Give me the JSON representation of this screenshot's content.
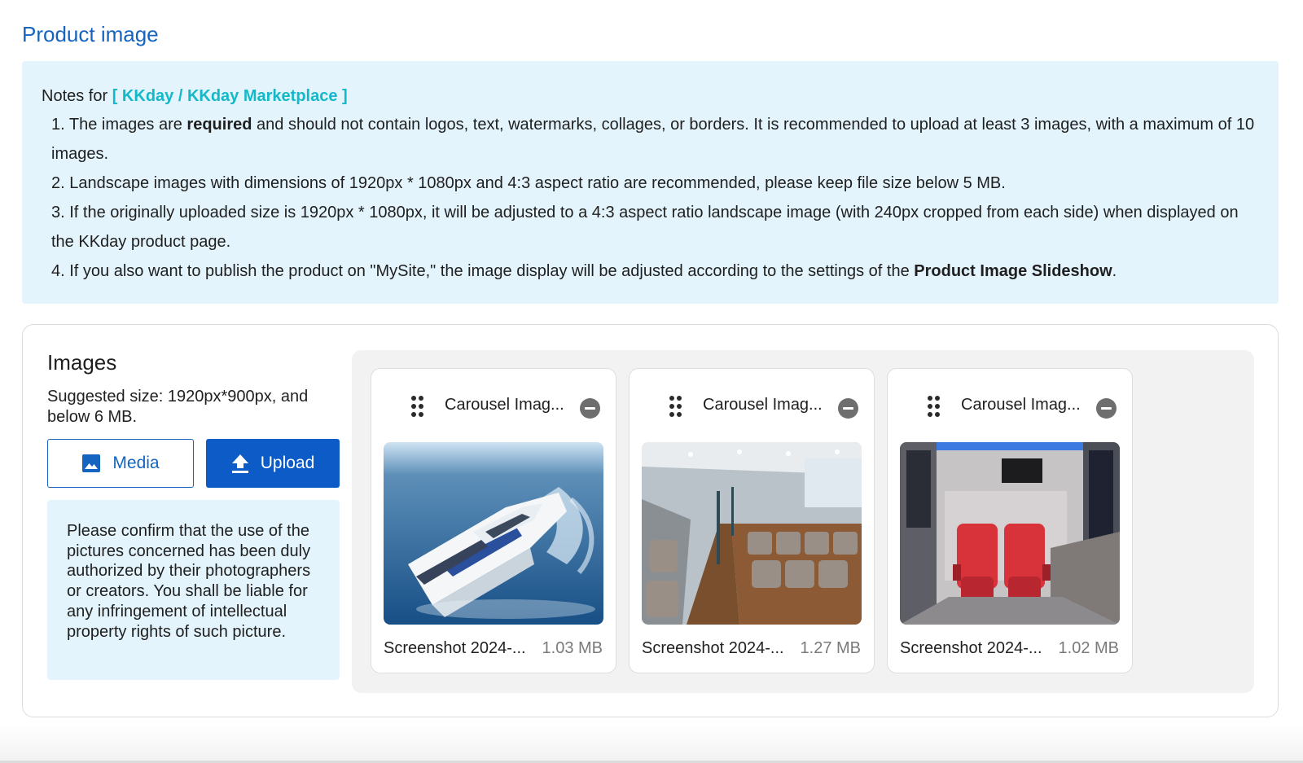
{
  "section": {
    "title": "Product image"
  },
  "notes": {
    "prefix": "Notes for",
    "platform": "[ KKday / KKday Marketplace ]",
    "item1_num": "1.",
    "item1_a": "The images are",
    "item1_bold": "required",
    "item1_b": "and should not contain logos, text, watermarks, collages, or borders. It is recommended to upload at least 3 images, with a maximum of 10 images.",
    "item2_num": "2.",
    "item2": "Landscape images with dimensions of 1920px * 1080px and 4:3 aspect ratio are recommended, please keep file size below 5 MB.",
    "item3_num": "3.",
    "item3": "If the originally uploaded size is 1920px * 1080px, it will be adjusted to a 4:3 aspect ratio landscape image (with 240px cropped from each side) when displayed on the KKday product page.",
    "item4_num": "4.",
    "item4_a": "If you also want to publish the product on \"MySite,\" the image display will be adjusted according to the settings of the",
    "item4_bold": "Product Image Slideshow",
    "item4_end": "."
  },
  "images": {
    "title": "Images",
    "suggested": "Suggested size: 1920px*900px, and below 6 MB.",
    "media_label": "Media",
    "upload_label": "Upload",
    "confirm_text": "Please confirm that the use of the pictures concerned has been duly authorized by their photographers or creators. You shall be liable for any infringement of intellectual property rights of such picture."
  },
  "tiles": [
    {
      "name": "Carousel Imag...",
      "file": "Screenshot 2024-...",
      "size": "1.03 MB"
    },
    {
      "name": "Carousel Imag...",
      "file": "Screenshot 2024-...",
      "size": "1.27 MB"
    },
    {
      "name": "Carousel Imag...",
      "file": "Screenshot 2024-...",
      "size": "1.02 MB"
    }
  ],
  "icons": {
    "media": "image-icon",
    "upload": "upload-icon",
    "drag": "drag-handle-icon",
    "remove": "remove-circle-icon"
  },
  "colors": {
    "accent": "#1565c0",
    "primary_button": "#0d5bc6",
    "platform_text": "#14b8c8",
    "notes_bg": "#e3f4fc"
  }
}
